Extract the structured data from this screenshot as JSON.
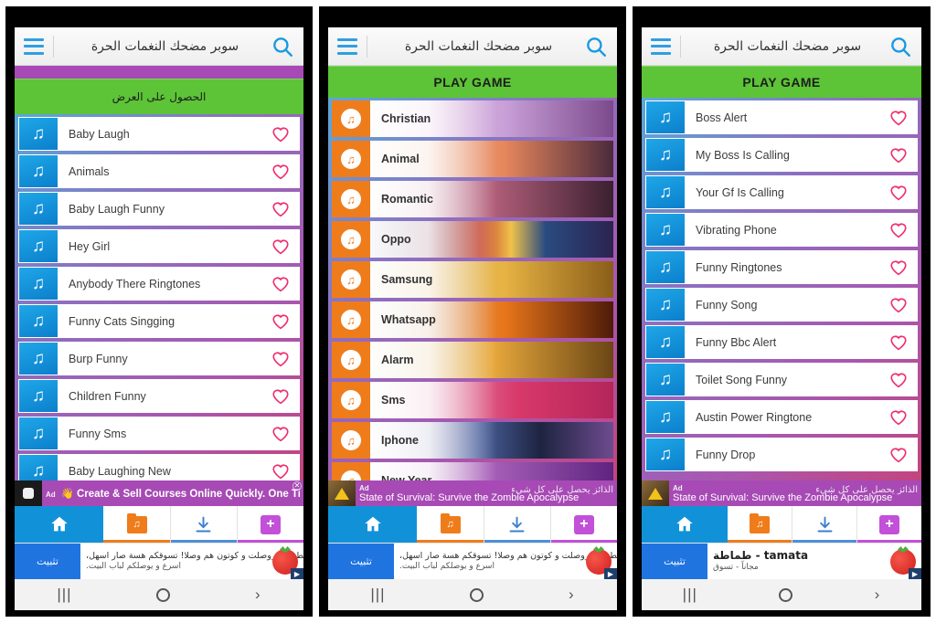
{
  "app": {
    "title": "سوبر مضحك النغمات الحرة",
    "hamburger_icon": "hamburger-menu-icon",
    "search_icon": "search-icon"
  },
  "colors": {
    "appbar_bg": "#f4f4f4",
    "purple_strip": "#a74ab5",
    "green_banner": "#5cc436",
    "blue_thumb": "#0b7fcc",
    "orange_thumb": "#ef7c1b",
    "heart": "#ef2d6d",
    "nav_active": "#1192d8",
    "ad_purple": "#a74ab5"
  },
  "panels": [
    {
      "id": "panel-1",
      "banner": {
        "label": "الحصول على العرض",
        "rtl": true
      },
      "list_style": "blue",
      "items": [
        {
          "label": "Baby Laugh"
        },
        {
          "label": "Animals"
        },
        {
          "label": "Baby Laugh Funny"
        },
        {
          "label": "Hey Girl"
        },
        {
          "label": "Anybody There Ringtones"
        },
        {
          "label": "Funny Cats Singging"
        },
        {
          "label": "Burp Funny"
        },
        {
          "label": "Children Funny"
        },
        {
          "label": "Funny Sms"
        },
        {
          "label": "Baby Laughing New"
        }
      ],
      "ad": {
        "tag": "Ad",
        "icon": "sparkle-icon",
        "line1": "Create & Sell Courses Online Quickly. One Time Deal",
        "line2": ""
      },
      "sponsor": {
        "button": "تثبيت",
        "line1": "القطو_اني_وصلت و كوتون هم وصلا! تسوقكم هسة صار اسهل،",
        "line2": "اسرع و يوصلكم لباب البيت.",
        "brand": ""
      }
    },
    {
      "id": "panel-2",
      "banner": {
        "label": "PLAY GAME",
        "rtl": false
      },
      "list_style": "image",
      "items": [
        {
          "label": "Christian",
          "art": "art-a"
        },
        {
          "label": "Animal",
          "art": "art-b"
        },
        {
          "label": "Romantic",
          "art": "art-c"
        },
        {
          "label": "Oppo",
          "art": "art-d"
        },
        {
          "label": "Samsung",
          "art": "art-e"
        },
        {
          "label": "Whatsapp",
          "art": "art-f"
        },
        {
          "label": "Alarm",
          "art": "art-g"
        },
        {
          "label": "Sms",
          "art": "art-h"
        },
        {
          "label": "Iphone",
          "art": "art-i"
        },
        {
          "label": "New Year",
          "art": "art-j"
        }
      ],
      "ad": {
        "tag": "Ad",
        "icon": "warning-triangle-icon",
        "rtl": "الذائز يحصل على كل شيء",
        "line2": "State of Survival: Survive the Zombie Apocalypse"
      },
      "sponsor": {
        "button": "تثبيت",
        "line1": "القطو_اني_وصلت و كوتون هم وصلا! تسوقكم هسة صار اسهل،",
        "line2": "اسرع و يوصلكم لباب البيت.",
        "brand": ""
      }
    },
    {
      "id": "panel-3",
      "banner": {
        "label": "PLAY GAME",
        "rtl": false
      },
      "list_style": "blue",
      "items": [
        {
          "label": "Boss Alert"
        },
        {
          "label": "My Boss Is Calling"
        },
        {
          "label": "Your Gf Is Calling"
        },
        {
          "label": "Vibrating Phone"
        },
        {
          "label": "Funny Ringtones"
        },
        {
          "label": "Funny Song"
        },
        {
          "label": "Funny Bbc Alert"
        },
        {
          "label": "Toilet Song Funny"
        },
        {
          "label": "Austin Power Ringtone"
        },
        {
          "label": "Funny Drop"
        }
      ],
      "ad": {
        "tag": "Ad",
        "icon": "warning-triangle-icon",
        "rtl": "الذائز يحصل على كل شيء",
        "line2": "State of Survival: Survive the Zombie Apocalypse"
      },
      "sponsor": {
        "button": "تثبيت",
        "brand": "tamata - طماطة",
        "line2": "مجاناً - تسوق",
        "line1": ""
      }
    }
  ],
  "bottom_nav": {
    "items": [
      {
        "name": "home",
        "icon": "home-icon",
        "active": true
      },
      {
        "name": "my-music",
        "icon": "music-folder-icon",
        "active": false
      },
      {
        "name": "downloads",
        "icon": "download-icon",
        "active": false
      },
      {
        "name": "add",
        "icon": "plus-icon",
        "active": false
      }
    ]
  },
  "system_nav": {
    "recents": "|||",
    "home": "O",
    "back": "›"
  }
}
